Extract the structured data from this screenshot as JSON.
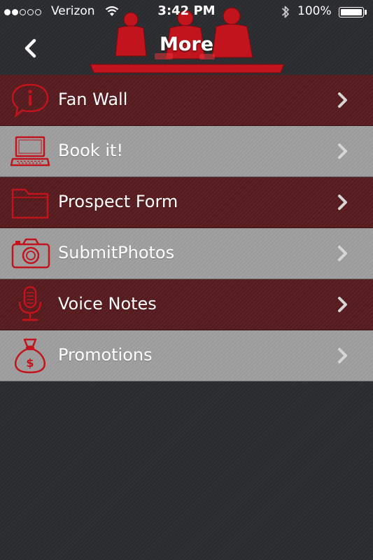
{
  "colors": {
    "accent_red": "#c1141c",
    "row_dark": "#561b1f",
    "row_light": "#9c9c9c",
    "background": "#2b2c30"
  },
  "status_bar": {
    "carrier": "Verizon",
    "time": "3:42 PM",
    "battery": "100%",
    "signal_bars_filled": 2,
    "signal_bars_total": 5,
    "battery_level": 1.0
  },
  "nav": {
    "title": "More",
    "back_icon": "chevron-left-icon"
  },
  "menu": {
    "items": [
      {
        "label": "Fan Wall",
        "icon": "info-bubble-icon",
        "style": "dark"
      },
      {
        "label": "Book it!",
        "icon": "laptop-icon",
        "style": "light"
      },
      {
        "label": "Prospect Form",
        "icon": "folder-icon",
        "style": "dark"
      },
      {
        "label": "SubmitPhotos",
        "icon": "camera-icon",
        "style": "light"
      },
      {
        "label": "Voice Notes",
        "icon": "microphone-icon",
        "style": "dark"
      },
      {
        "label": "Promotions",
        "icon": "money-bag-icon",
        "style": "light"
      }
    ]
  }
}
